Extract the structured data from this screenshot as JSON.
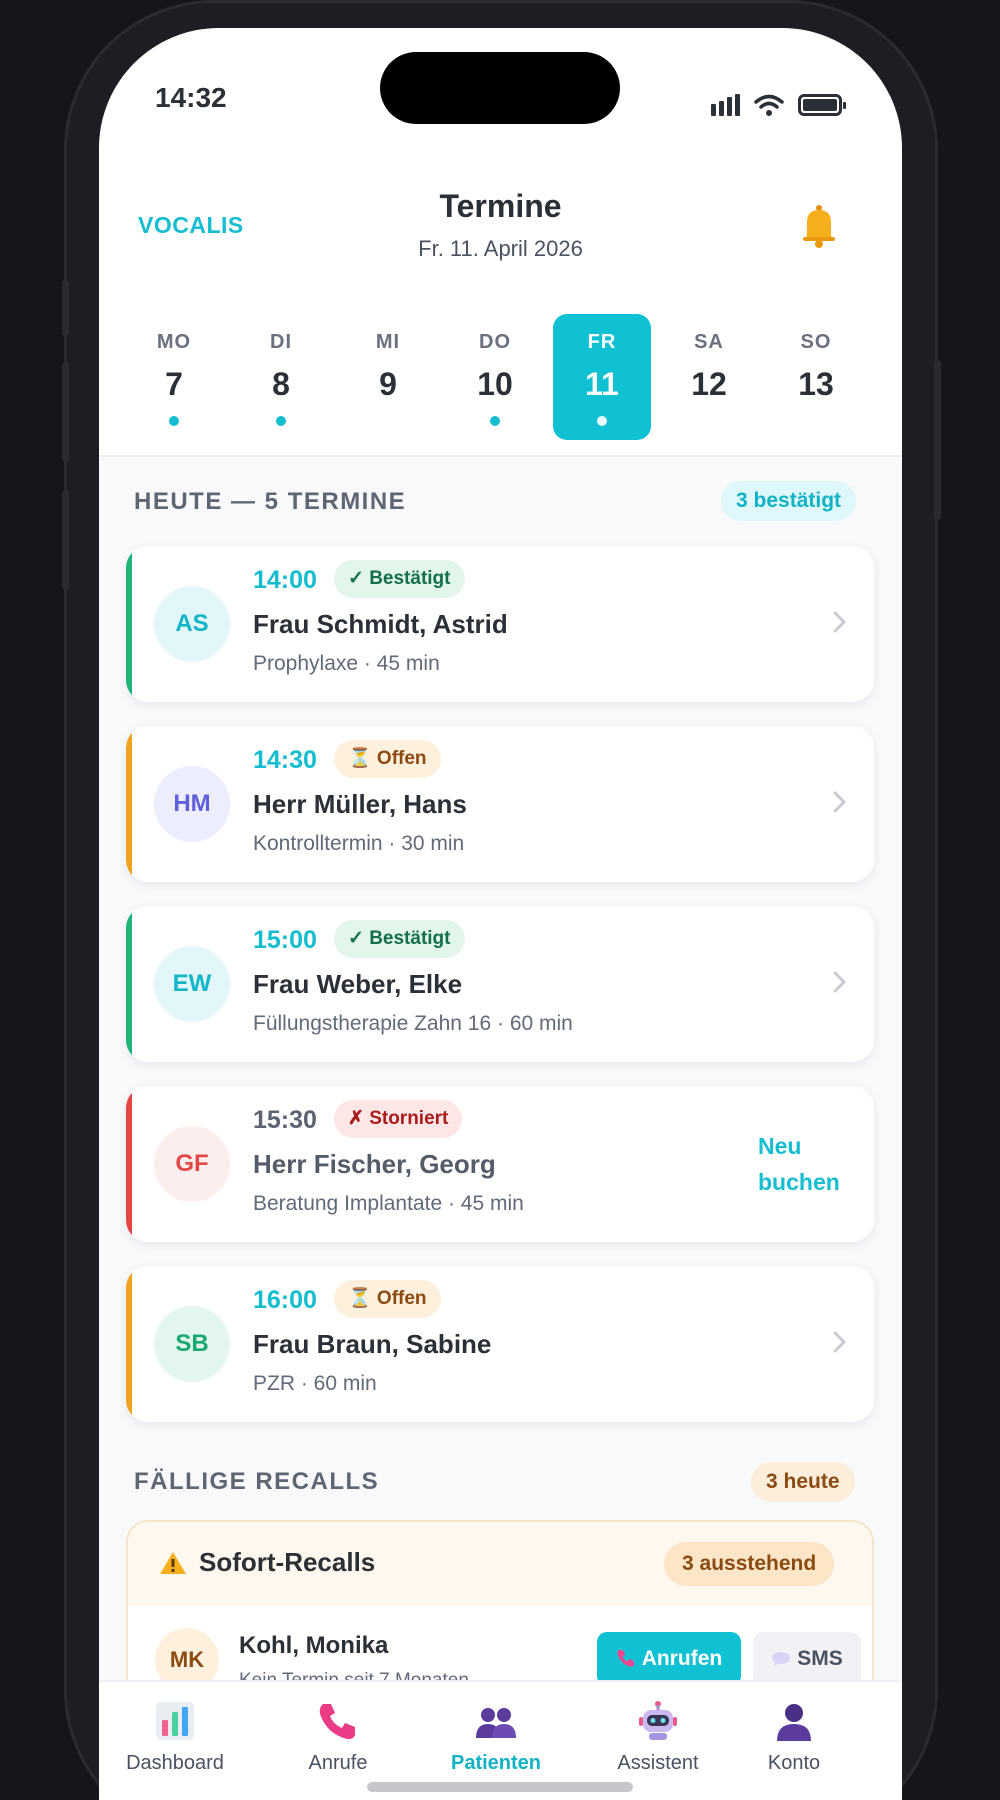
{
  "status_bar": {
    "time": "14:32"
  },
  "header": {
    "brand": "VOCALIS",
    "title": "Termine",
    "date": "Fr. 11. April 2026",
    "bell_icon": "bell-icon"
  },
  "week": [
    {
      "name": "MO",
      "num": "7",
      "has_appointments": true,
      "active": false
    },
    {
      "name": "DI",
      "num": "8",
      "has_appointments": true,
      "active": false
    },
    {
      "name": "MI",
      "num": "9",
      "has_appointments": false,
      "active": false
    },
    {
      "name": "DO",
      "num": "10",
      "has_appointments": true,
      "active": false
    },
    {
      "name": "FR",
      "num": "11",
      "has_appointments": true,
      "active": true
    },
    {
      "name": "SA",
      "num": "12",
      "has_appointments": false,
      "active": false
    },
    {
      "name": "SO",
      "num": "13",
      "has_appointments": false,
      "active": false
    }
  ],
  "today": {
    "title": "HEUTE — 5 TERMINE",
    "confirmed_badge": "3 bestätigt",
    "appointments": [
      {
        "initials": "AS",
        "time": "14:00",
        "status": "✓ Bestätigt",
        "status_type": "ok",
        "name": "Frau Schmidt, Astrid",
        "detail": "Prophylaxe · 45 min"
      },
      {
        "initials": "HM",
        "time": "14:30",
        "status": "⏳ Offen",
        "status_type": "open",
        "name": "Herr Müller, Hans",
        "detail": "Kontrolltermin · 30 min"
      },
      {
        "initials": "EW",
        "time": "15:00",
        "status": "✓ Bestätigt",
        "status_type": "ok",
        "name": "Frau Weber, Elke",
        "detail": "Füllungstherapie Zahn 16 · 60 min"
      },
      {
        "initials": "GF",
        "time": "15:30",
        "status": "✗ Storniert",
        "status_type": "cancel",
        "name": "Herr Fischer, Georg",
        "detail": "Beratung Implantate · 45 min",
        "action_line1": "Neu",
        "action_line2": "buchen"
      },
      {
        "initials": "SB",
        "time": "16:00",
        "status": "⏳ Offen",
        "status_type": "open",
        "name": "Frau Braun, Sabine",
        "detail": "PZR · 60 min"
      }
    ]
  },
  "recalls": {
    "title": "FÄLLIGE RECALLS",
    "today_badge": "3 heute",
    "box_title": "Sofort-Recalls",
    "pending_badge": "3 ausstehend",
    "items": [
      {
        "initials": "MK",
        "name": "Kohl, Monika",
        "detail": "Kein Termin seit 7 Monaten",
        "call_label": "Anrufen",
        "sms_label": "SMS"
      }
    ]
  },
  "tabs": [
    {
      "label": "Dashboard",
      "icon": "chart-icon",
      "active": false
    },
    {
      "label": "Anrufe",
      "icon": "phone-icon",
      "active": false
    },
    {
      "label": "Patienten",
      "icon": "people-icon",
      "active": true
    },
    {
      "label": "Assistent",
      "icon": "robot-icon",
      "active": false
    },
    {
      "label": "Konto",
      "icon": "user-icon",
      "active": false
    }
  ],
  "colors": {
    "accent": "#10c1d3",
    "confirmed": "#1db37a",
    "open": "#f2a31c",
    "cancelled": "#e64545"
  }
}
